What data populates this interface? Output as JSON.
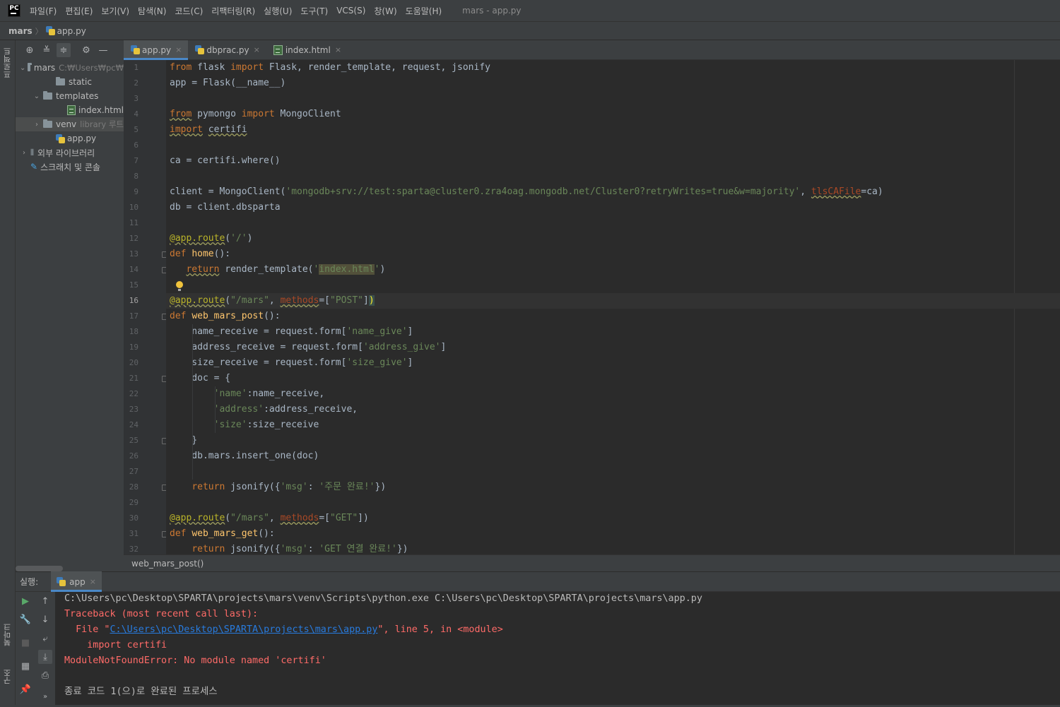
{
  "app": {
    "logo": "PC",
    "window_title": "mars - app.py"
  },
  "menu": [
    "파일(F)",
    "편집(E)",
    "보기(V)",
    "탐색(N)",
    "코드(C)",
    "리팩터링(R)",
    "실행(U)",
    "도구(T)",
    "VCS(S)",
    "창(W)",
    "도움말(H)"
  ],
  "breadcrumb": {
    "project": "mars",
    "separator": "〉",
    "file": "app.py"
  },
  "side_tabs": {
    "project": "프로젝트",
    "bookmarks": "북마크",
    "structure": "구조"
  },
  "project_tree": [
    {
      "label": "mars",
      "hint": "C:₩Users₩pc₩",
      "kind": "folder",
      "depth": 0,
      "expanded": true
    },
    {
      "label": "static",
      "hint": "",
      "kind": "folder",
      "depth": 2,
      "expanded": false
    },
    {
      "label": "templates",
      "hint": "",
      "kind": "folder",
      "depth": 1,
      "expanded": true
    },
    {
      "label": "index.html",
      "hint": "",
      "kind": "html",
      "depth": 3,
      "expanded": false
    },
    {
      "label": "venv",
      "hint": "library 루트",
      "kind": "folder",
      "depth": 1,
      "expanded": false,
      "selected": true
    },
    {
      "label": "app.py",
      "hint": "",
      "kind": "python",
      "depth": 2,
      "expanded": false
    },
    {
      "label": "외부 라이브러리",
      "hint": "",
      "kind": "libraries",
      "depth": 0,
      "expanded": false
    },
    {
      "label": "스크래치 및 콘솔",
      "hint": "",
      "kind": "scratch",
      "depth": 0,
      "expanded": false
    }
  ],
  "editor_tabs": [
    {
      "label": "app.py",
      "type": "python",
      "active": true,
      "close": "×"
    },
    {
      "label": "dbprac.py",
      "type": "python",
      "active": false,
      "close": "×"
    },
    {
      "label": "index.html",
      "type": "html",
      "active": false,
      "close": "×"
    }
  ],
  "code_lines": [
    "from flask import Flask, render_template, request, jsonify",
    "app = Flask(__name__)",
    "",
    "from pymongo import MongoClient",
    "import certifi",
    "",
    "ca = certifi.where()",
    "",
    "client = MongoClient('mongodb+srv://test:sparta@cluster0.zra4oag.mongodb.net/Cluster0?retryWrites=true&w=majority', tlsCAFile=ca)",
    "db = client.dbsparta",
    "",
    "@app.route('/')",
    "def home():",
    "   return render_template('index.html')",
    "",
    "@app.route(\"/mars\", methods=[\"POST\"])",
    "def web_mars_post():",
    "    name_receive = request.form['name_give']",
    "    address_receive = request.form['address_give']",
    "    size_receive = request.form['size_give']",
    "    doc = {",
    "        'name':name_receive,",
    "        'address':address_receive,",
    "        'size':size_receive",
    "    }",
    "    db.mars.insert_one(doc)",
    "",
    "    return jsonify({'msg': '주문 완료!'})",
    "",
    "@app.route(\"/mars\", methods=[\"GET\"])",
    "def web_mars_get():",
    "    return jsonify({'msg': 'GET 연결 완료!'})"
  ],
  "current_line": 16,
  "editor_breadcrumb": "web_mars_post()",
  "run": {
    "label": "실행:",
    "tab": "app",
    "tab_close": "×",
    "command": "C:\\Users\\pc\\Desktop\\SPARTA\\projects\\mars\\venv\\Scripts\\python.exe C:\\Users\\pc\\Desktop\\SPARTA\\projects\\mars\\app.py",
    "traceback": "Traceback (most recent call last):",
    "file_prefix": "  File \"",
    "file_link": "C:\\Users\\pc\\Desktop\\SPARTA\\projects\\mars\\app.py",
    "file_suffix": "\", line 5, in <module>",
    "source": "    import certifi",
    "error": "ModuleNotFoundError: No module named 'certifi'",
    "exit": "종료 코드 1(으)로 완료된 프로세스"
  },
  "colors": {
    "keyword": "#cc7832",
    "string": "#6a8759",
    "decorator": "#bbb529",
    "function": "#ffc66d",
    "error": "#ff6b68",
    "link": "#287bde",
    "accent": "#4a88c7"
  }
}
